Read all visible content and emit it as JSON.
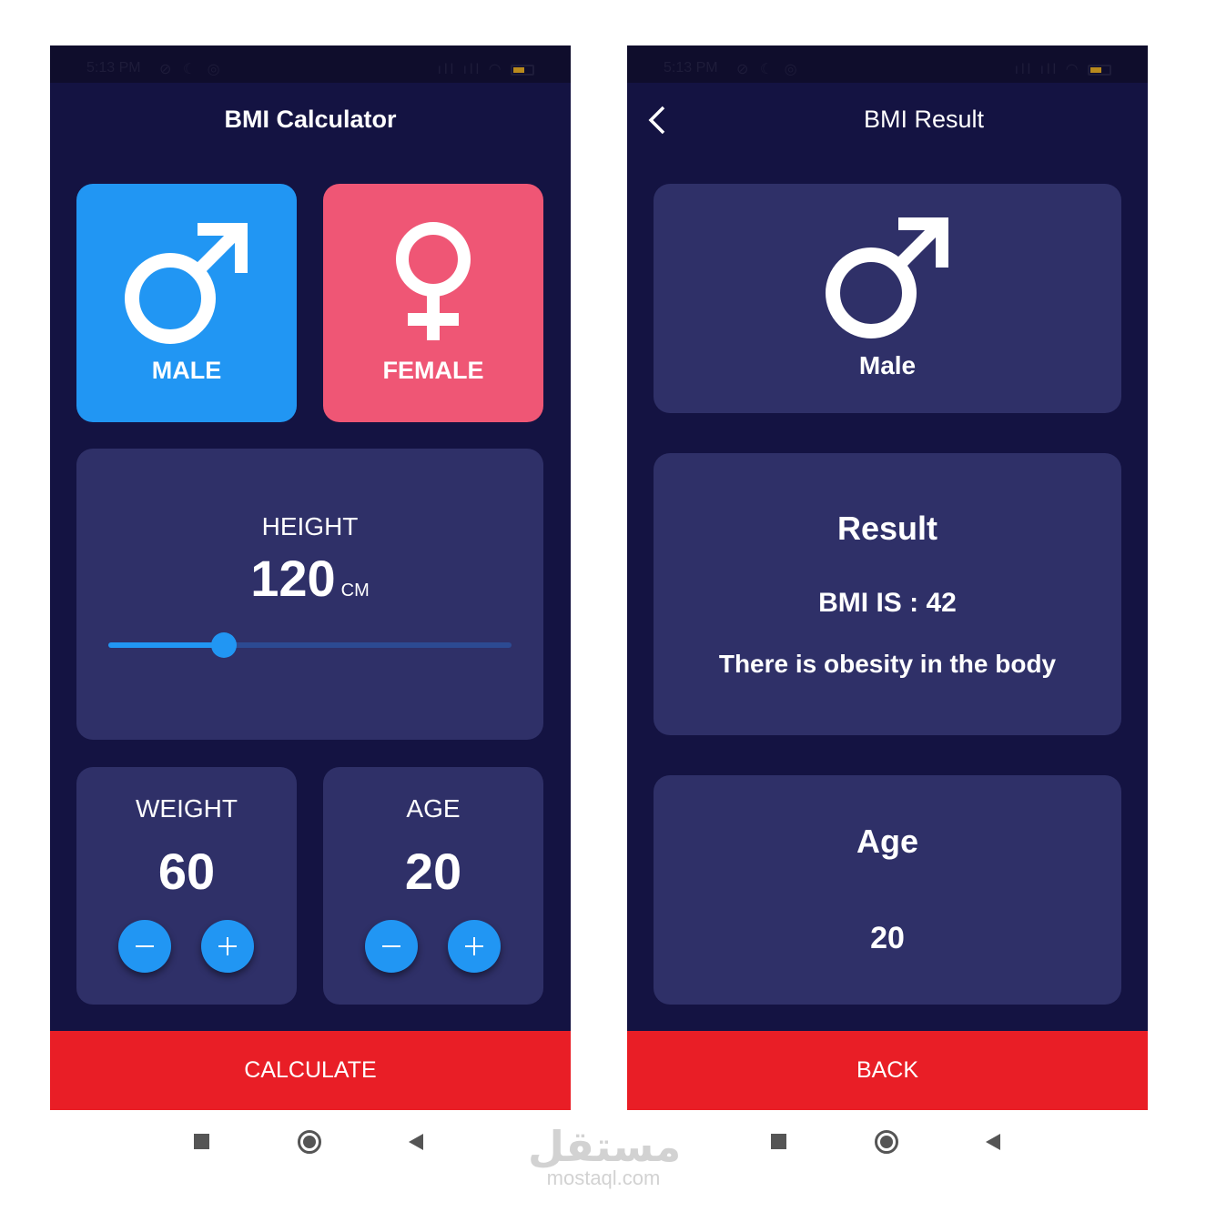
{
  "status_bar": {
    "time": "5:13 PM",
    "battery": "4"
  },
  "calculator_screen": {
    "title": "BMI Calculator",
    "male_label": "MALE",
    "female_label": "FEMALE",
    "height": {
      "label": "HEIGHT",
      "value": "120",
      "unit": "CM",
      "slider_fraction": 0.286
    },
    "weight": {
      "label": "WEIGHT",
      "value": "60"
    },
    "age": {
      "label": "AGE",
      "value": "20"
    },
    "calculate_label": "CALCULATE"
  },
  "result_screen": {
    "title": "BMI Result",
    "gender_label": "Male",
    "result_heading": "Result",
    "bmi_text": "BMI IS : 42",
    "message": "There is obesity in the body",
    "age_heading": "Age",
    "age_value": "20",
    "back_label": "BACK"
  },
  "watermark": {
    "arabic": "مستقل",
    "latin": "mostaql.com"
  },
  "colors": {
    "background": "#141342",
    "card": "#2f3068",
    "male": "#2196f3",
    "female": "#ef5675",
    "accent_button": "#e91e26"
  },
  "icons": [
    "male-symbol-icon",
    "female-symbol-icon",
    "minus-icon",
    "plus-icon",
    "back-arrow-icon",
    "nav-square-icon",
    "nav-home-icon",
    "nav-back-icon"
  ]
}
